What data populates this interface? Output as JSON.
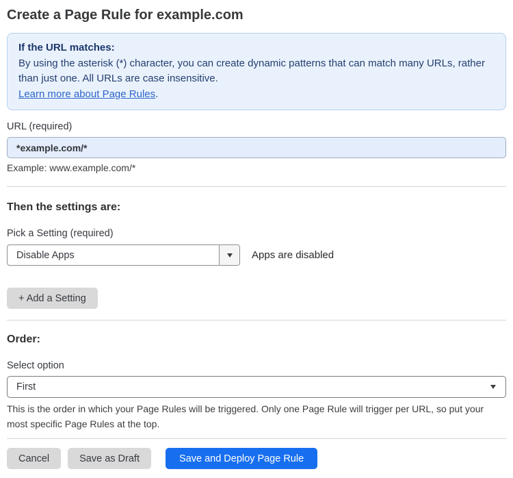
{
  "page": {
    "title": "Create a Page Rule for example.com"
  },
  "info_box": {
    "heading": "If the URL matches:",
    "body": "By using the asterisk (*) character, you can create dynamic patterns that can match many URLs, rather than just one. All URLs are case insensitive.",
    "link_label": "Learn more about Page Rules",
    "link_suffix": "."
  },
  "url_field": {
    "label": "URL (required)",
    "value": "*example.com/*",
    "helper": "Example: www.example.com/*"
  },
  "settings_section": {
    "heading": "Then the settings are:",
    "picker_label": "Pick a Setting (required)",
    "picker_value": "Disable Apps",
    "picker_status": "Apps are disabled",
    "add_setting_label": "+ Add a Setting"
  },
  "order_section": {
    "heading": "Order:",
    "select_label": "Select option",
    "select_value": "First",
    "helper": "This is the order in which your Page Rules will be triggered. Only one Page Rule will trigger per URL, so put your most specific Page Rules at the top."
  },
  "footer": {
    "cancel_label": "Cancel",
    "save_draft_label": "Save as Draft",
    "save_deploy_label": "Save and Deploy Page Rule"
  },
  "icons": {
    "dropdown_caret": "chevron-down"
  },
  "colors": {
    "accent_blue": "#176ff0",
    "info_box_bg": "#e9f2fc",
    "info_box_border": "#b7d0ee",
    "info_text": "#233c6d",
    "link_blue": "#2d64c8",
    "input_bg": "#e3edfb",
    "gray_button_bg": "#d9d9d9"
  }
}
